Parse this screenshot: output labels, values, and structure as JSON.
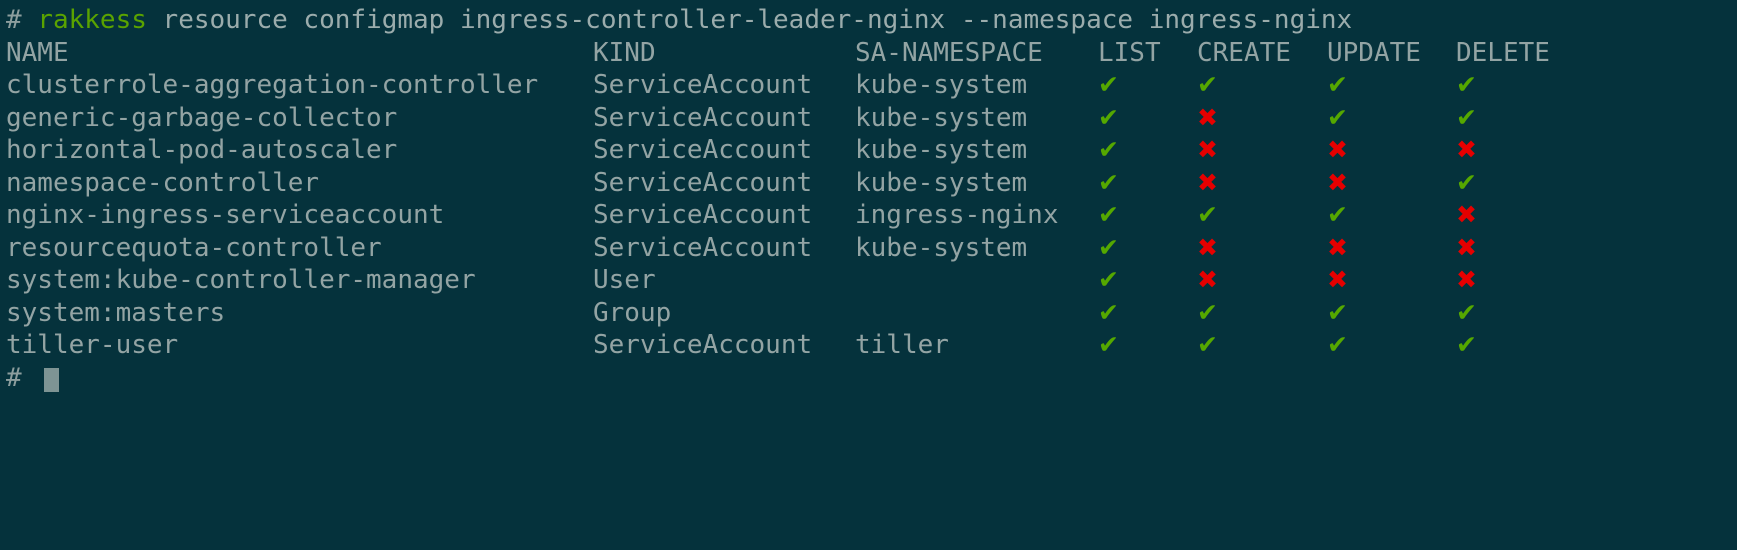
{
  "terminal": {
    "background_color": "#05323c",
    "foreground_color": "#93a4a4",
    "accent_green": "#55a800",
    "accent_red": "#e60000",
    "command_name_color": "#5aa300"
  },
  "command": {
    "prompt": "# ",
    "name": "rakkess",
    "args": " resource configmap ingress-controller-leader-nginx --namespace ingress-nginx",
    "full": "# rakkess resource configmap ingress-controller-leader-nginx --namespace ingress-nginx"
  },
  "table": {
    "headers": {
      "name": "NAME",
      "kind": "KIND",
      "sa_namespace": "SA-NAMESPACE",
      "list": "LIST",
      "create": "CREATE",
      "update": "UPDATE",
      "delete": "DELETE"
    },
    "rows": [
      {
        "name": "clusterrole-aggregation-controller",
        "kind": "ServiceAccount",
        "sa_namespace": "kube-system",
        "list": "✔",
        "create": "✔",
        "update": "✔",
        "delete": "✔",
        "list_allowed": true,
        "create_allowed": true,
        "update_allowed": true,
        "delete_allowed": true
      },
      {
        "name": "generic-garbage-collector",
        "kind": "ServiceAccount",
        "sa_namespace": "kube-system",
        "list": "✔",
        "create": "✖",
        "update": "✔",
        "delete": "✔",
        "list_allowed": true,
        "create_allowed": false,
        "update_allowed": true,
        "delete_allowed": true
      },
      {
        "name": "horizontal-pod-autoscaler",
        "kind": "ServiceAccount",
        "sa_namespace": "kube-system",
        "list": "✔",
        "create": "✖",
        "update": "✖",
        "delete": "✖",
        "list_allowed": true,
        "create_allowed": false,
        "update_allowed": false,
        "delete_allowed": false
      },
      {
        "name": "namespace-controller",
        "kind": "ServiceAccount",
        "sa_namespace": "kube-system",
        "list": "✔",
        "create": "✖",
        "update": "✖",
        "delete": "✔",
        "list_allowed": true,
        "create_allowed": false,
        "update_allowed": false,
        "delete_allowed": true
      },
      {
        "name": "nginx-ingress-serviceaccount",
        "kind": "ServiceAccount",
        "sa_namespace": "ingress-nginx",
        "list": "✔",
        "create": "✔",
        "update": "✔",
        "delete": "✖",
        "list_allowed": true,
        "create_allowed": true,
        "update_allowed": true,
        "delete_allowed": false
      },
      {
        "name": "resourcequota-controller",
        "kind": "ServiceAccount",
        "sa_namespace": "kube-system",
        "list": "✔",
        "create": "✖",
        "update": "✖",
        "delete": "✖",
        "list_allowed": true,
        "create_allowed": false,
        "update_allowed": false,
        "delete_allowed": false
      },
      {
        "name": "system:kube-controller-manager",
        "kind": "User",
        "sa_namespace": "",
        "list": "✔",
        "create": "✖",
        "update": "✖",
        "delete": "✖",
        "list_allowed": true,
        "create_allowed": false,
        "update_allowed": false,
        "delete_allowed": false
      },
      {
        "name": "system:masters",
        "kind": "Group",
        "sa_namespace": "",
        "list": "✔",
        "create": "✔",
        "update": "✔",
        "delete": "✔",
        "list_allowed": true,
        "create_allowed": true,
        "update_allowed": true,
        "delete_allowed": true
      },
      {
        "name": "tiller-user",
        "kind": "ServiceAccount",
        "sa_namespace": "tiller",
        "list": "✔",
        "create": "✔",
        "update": "✔",
        "delete": "✔",
        "list_allowed": true,
        "create_allowed": true,
        "update_allowed": true,
        "delete_allowed": true
      }
    ]
  },
  "final_prompt": {
    "prompt": "# "
  }
}
